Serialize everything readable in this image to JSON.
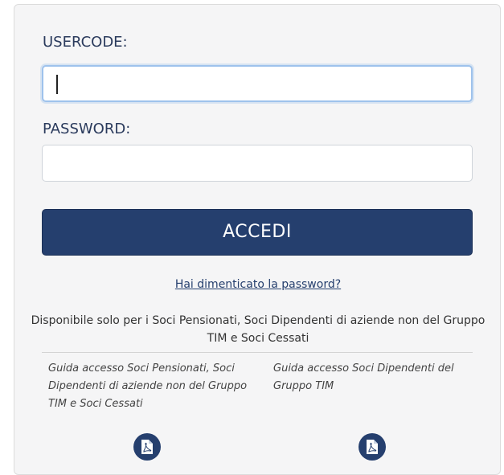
{
  "login": {
    "usercode_label": "USERCODE:",
    "usercode_value": "",
    "password_label": "PASSWORD:",
    "password_value": "",
    "submit_label": "ACCEDI",
    "forgot_link": "Hai dimenticato la password?",
    "info_text": "Disponibile solo per i Soci Pensionati, Soci Dipendenti di aziende non del Gruppo TIM e Soci Cessati"
  },
  "guides": [
    {
      "text": "Guida accesso Soci Pensionati, Soci Dipendenti di aziende non del Gruppo TIM e Soci Cessati",
      "icon": "pdf-icon"
    },
    {
      "text": "Guida accesso Soci Dipendenti del Gruppo TIM",
      "icon": "pdf-icon"
    }
  ],
  "colors": {
    "primary": "#253f6e",
    "panel_bg": "#f5f5f6",
    "focus_border": "#9ec2ec"
  }
}
